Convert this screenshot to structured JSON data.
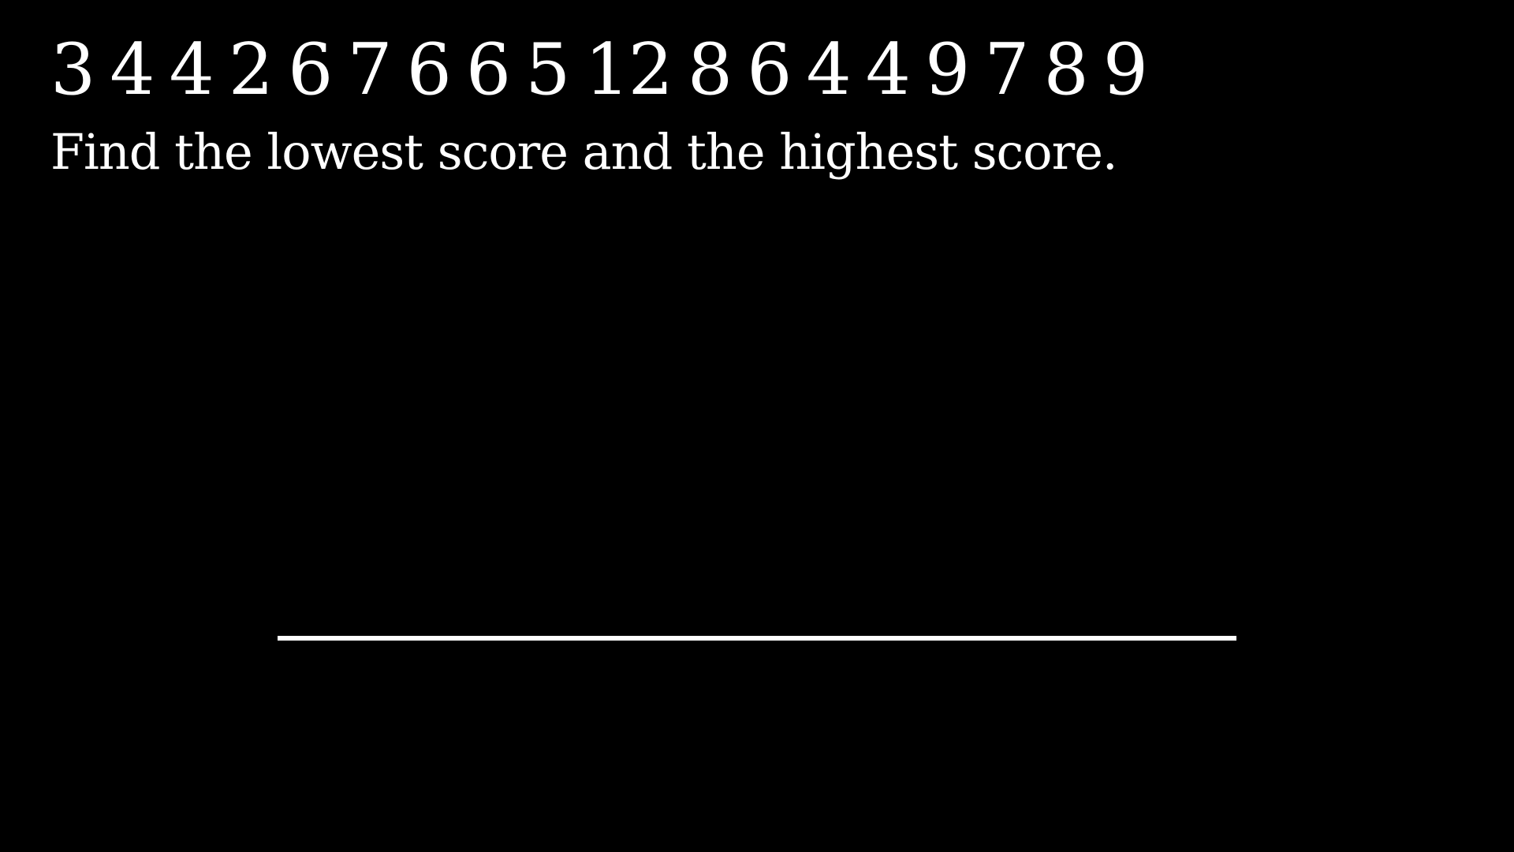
{
  "colors": {
    "background": "#000000",
    "text": "#ffffff"
  },
  "scores": [
    "3",
    "4",
    "4",
    "2",
    "6",
    "7",
    "6",
    "6",
    "5",
    "12",
    "8",
    "6",
    "4",
    "4",
    "9",
    "7",
    "8",
    "9"
  ],
  "prompt": "Find the lowest score and the highest score."
}
